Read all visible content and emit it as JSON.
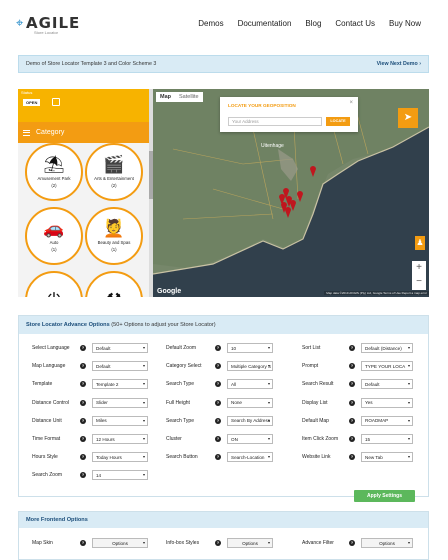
{
  "header": {
    "logo_text": "AGILE",
    "logo_sub": "Store Locator",
    "nav": [
      "Demos",
      "Documentation",
      "Blog",
      "Contact Us",
      "Buy Now"
    ]
  },
  "demo_bar": {
    "text": "Demo of Store Locator Template 3 and Color Scheme 3",
    "next": "View Next Demo"
  },
  "panel": {
    "status_label": "Status",
    "open": "OPEN",
    "category": "Category",
    "items": [
      {
        "name": "Amusement Park",
        "count": "(2)",
        "icon": "carousel-icon",
        "glyph": "⛱"
      },
      {
        "name": "Arts & Entertainment",
        "count": "(2)",
        "icon": "clapper-icon",
        "glyph": "🎬"
      },
      {
        "name": "Auto",
        "count": "(1)",
        "icon": "car-icon",
        "glyph": "🚗"
      },
      {
        "name": "Beauty and Spas",
        "count": "(1)",
        "icon": "spa-icon",
        "glyph": "💆"
      },
      {
        "name": "",
        "count": "",
        "icon": "power-icon",
        "glyph": "⏻"
      },
      {
        "name": "",
        "count": "",
        "icon": "hammer-icon",
        "glyph": "⚒"
      }
    ]
  },
  "map": {
    "tab_map": "Map",
    "tab_sat": "Satellite",
    "geo_title": "LOCATE YOUR GEOPOSITION",
    "geo_placeholder": "Your Address",
    "geo_button": "LOCATE",
    "google": "Google",
    "footer": "Map data ©2019 AfriGIS (Pty) Ltd, Google  Terms of Use  Report a map error",
    "label_town": "Uitenhage"
  },
  "advanced": {
    "title": "Store Locator Advance Options",
    "subtitle": "(50+ Options to adjust your Store Locator)",
    "rows": [
      [
        {
          "label": "Select Language",
          "value": "Default"
        },
        {
          "label": "Default Zoom",
          "value": "10"
        },
        {
          "label": "Sort List",
          "value": "Default (Distance)"
        }
      ],
      [
        {
          "label": "Map Language",
          "value": "Default"
        },
        {
          "label": "Category Select",
          "value": "Multiple Category S"
        },
        {
          "label": "Prompt",
          "value": "TYPE YOUR LOCA"
        }
      ],
      [
        {
          "label": "Template",
          "value": "Template 2"
        },
        {
          "label": "Search Type",
          "value": "All"
        },
        {
          "label": "Search Result",
          "value": "Default"
        }
      ],
      [
        {
          "label": "Distance Control",
          "value": "Slider"
        },
        {
          "label": "Full Height",
          "value": "None"
        },
        {
          "label": "Display List",
          "value": "Yes"
        }
      ],
      [
        {
          "label": "Distance Unit",
          "value": "Miles"
        },
        {
          "label": "Search Type",
          "value": "Search By Address"
        },
        {
          "label": "Default Map",
          "value": "ROADMAP"
        }
      ],
      [
        {
          "label": "Time Format",
          "value": "12 Hours"
        },
        {
          "label": "Cluster",
          "value": "ON"
        },
        {
          "label": "Item Click Zoom",
          "value": "15"
        }
      ],
      [
        {
          "label": "Hours Style",
          "value": "Today Hours"
        },
        {
          "label": "Search Button",
          "value": "Search-Location"
        },
        {
          "label": "Website Link",
          "value": "New Tab"
        }
      ],
      [
        {
          "label": "Search Zoom",
          "value": "14"
        }
      ]
    ],
    "apply": "Apply Settings"
  },
  "more": {
    "title": "More Frontend Options",
    "rows": [
      {
        "label": "Map Skin",
        "value": "Options"
      },
      {
        "label": "Info-box Styles",
        "value": "Options"
      },
      {
        "label": "Advance Filter",
        "value": "Options"
      }
    ]
  },
  "colors": {
    "accent": "#f39c12",
    "status": "#f7b300",
    "bar": "#d9ebf5",
    "apply": "#5cb85c"
  }
}
